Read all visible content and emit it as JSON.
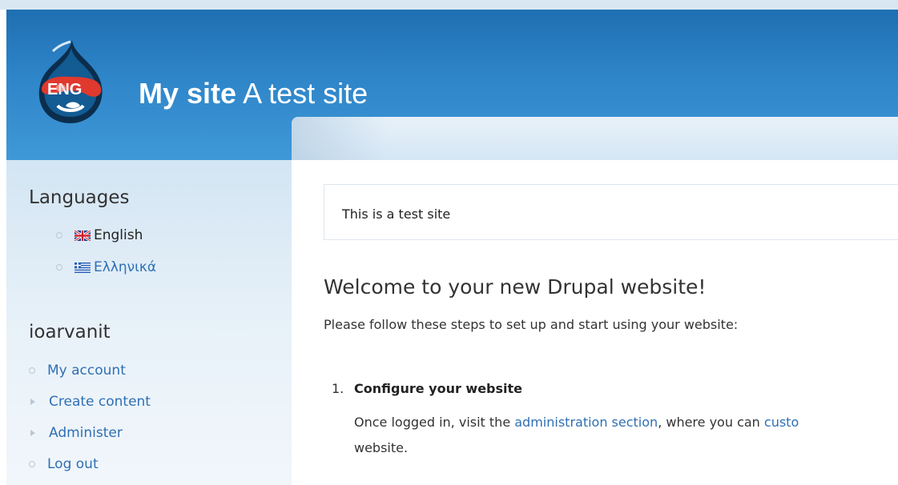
{
  "header": {
    "logo_text": "ENG",
    "site_name": "My site",
    "site_slogan": "A test site"
  },
  "sidebar": {
    "languages_title": "Languages",
    "languages": [
      {
        "label": "English",
        "flag": "uk-flag-icon",
        "active": true
      },
      {
        "label": "Ελληνικά",
        "flag": "greek-flag-icon",
        "active": false
      }
    ],
    "user_title": "ioarvanit",
    "user_menu": [
      {
        "label": "My account",
        "bullet": "leaf"
      },
      {
        "label": "Create content",
        "bullet": "collapsed"
      },
      {
        "label": "Administer",
        "bullet": "collapsed"
      },
      {
        "label": "Log out",
        "bullet": "leaf"
      }
    ]
  },
  "main": {
    "mission": "This is a test site",
    "welcome_title": "Welcome to your new Drupal website!",
    "welcome_sub": "Please follow these steps to set up and start using your website:",
    "step1_number": "1.",
    "step1_title": "Configure your website",
    "step1_text_before": "Once logged in, visit the ",
    "step1_link1": "administration section",
    "step1_text_middle": ", where you can ",
    "step1_link2": "custo",
    "step1_text_line2": "website."
  },
  "colors": {
    "header_blue": "#2e85c8",
    "link_blue": "#2f6fb3",
    "sidebar_bg": "#e2eef8"
  }
}
